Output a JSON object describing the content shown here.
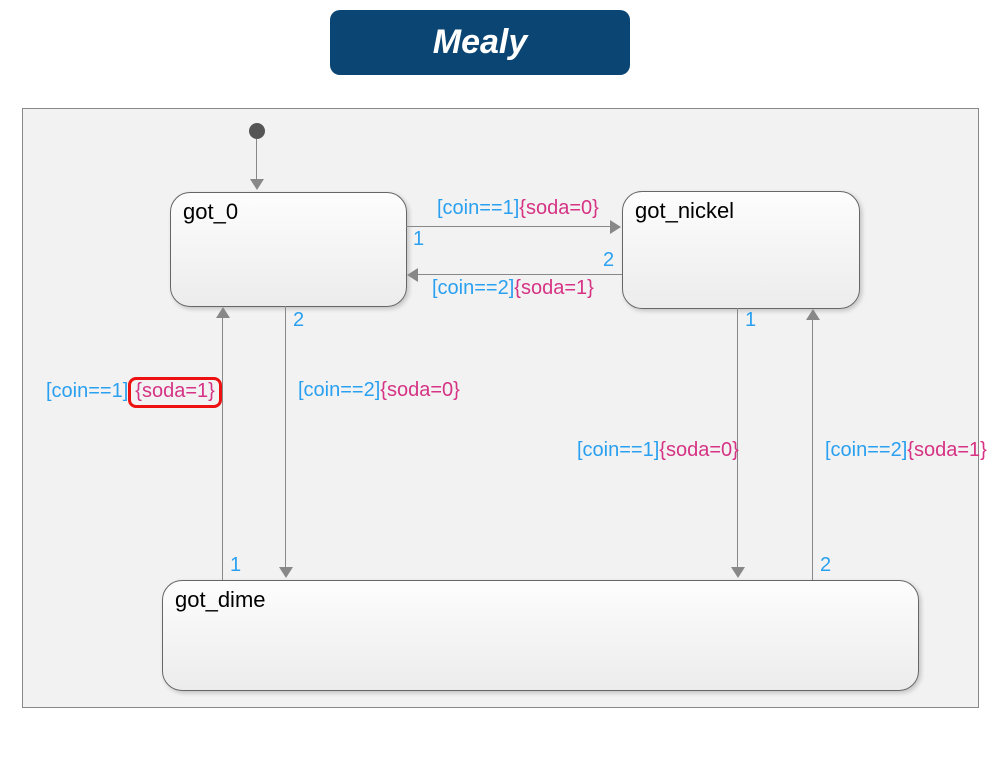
{
  "title": "Mealy",
  "states": {
    "got_0": "got_0",
    "got_nickel": "got_nickel",
    "got_dime": "got_dime"
  },
  "labels": {
    "t1_num": "1",
    "t1_cond": "[coin==1]",
    "t1_act": "{soda=0}",
    "t2_num": "2",
    "t2_cond": "[coin==2]",
    "t2_act": "{soda=1}",
    "t3_num": "2",
    "t3_cond": "[coin==2]",
    "t3_act": "{soda=0}",
    "t4_num": "1",
    "t4_cond": "[coin==1]",
    "t4_act": "{soda=1}",
    "t5_num": "1",
    "t5_cond": "[coin==1]",
    "t5_act": "{soda=0}",
    "t6_num": "2",
    "t6_cond": "[coin==2]",
    "t6_act": "{soda=1}"
  }
}
